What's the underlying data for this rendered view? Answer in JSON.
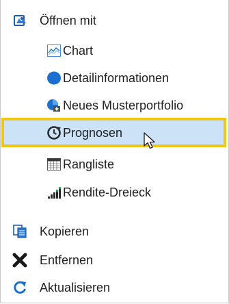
{
  "menu": {
    "open_with": "Öffnen mit",
    "submenu": [
      {
        "label": "Chart",
        "icon": "chart-icon"
      },
      {
        "label": "Detailinformationen",
        "icon": "detail-info-icon"
      },
      {
        "label": "Neues Musterportfolio",
        "icon": "new-portfolio-icon"
      },
      {
        "label": "Prognosen",
        "icon": "forecast-icon"
      },
      {
        "label": "Rangliste",
        "icon": "ranking-icon"
      },
      {
        "label": "Rendite-Dreieck",
        "icon": "return-triangle-icon"
      }
    ],
    "copy": "Kopieren",
    "remove": "Entfernen",
    "refresh": "Aktualisieren"
  },
  "colors": {
    "highlight_fill": "#cce2f6",
    "highlight_border": "#f2c615",
    "icon_blue": "#1a6fd1"
  }
}
